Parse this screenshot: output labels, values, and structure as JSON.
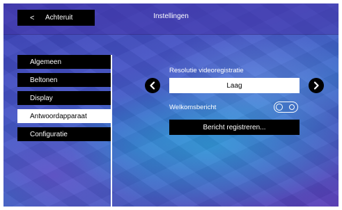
{
  "header": {
    "back_chevron": "<",
    "back_label": "Achteruit",
    "title": "Instellingen"
  },
  "sidebar": {
    "items": [
      {
        "label": "Algemeen",
        "active": false
      },
      {
        "label": "Beltonen",
        "active": false
      },
      {
        "label": "Display",
        "active": false
      },
      {
        "label": "Antwoordapparaat",
        "active": true
      },
      {
        "label": "Configuratie",
        "active": false
      }
    ]
  },
  "settings": {
    "resolution_label": "Resolutie videoregistratie",
    "resolution_value": "Laag",
    "prev_icon": "chevron-left-icon",
    "next_icon": "chevron-right-icon",
    "welcome_label": "Welkomsbericht",
    "welcome_toggle_on": false,
    "record_button_label": "Bericht registreren..."
  },
  "colors": {
    "button_bg": "#000000",
    "active_bg": "#ffffff",
    "text": "#ffffff"
  }
}
